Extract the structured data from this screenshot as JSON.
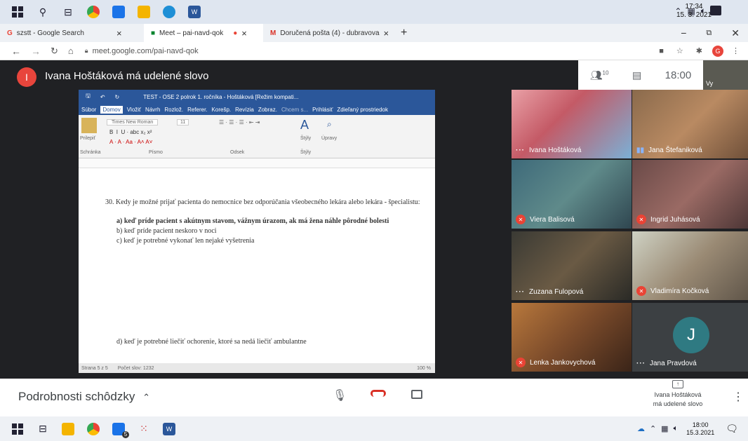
{
  "taskbar_top": {
    "icons": [
      "windows-icon",
      "search-icon",
      "task-view-icon",
      "chrome-icon",
      "mail-icon",
      "file-explorer-icon",
      "edge-icon",
      "word-icon"
    ],
    "clock_time": "17:34",
    "clock_date": "15. 3. 2021"
  },
  "tabs": [
    {
      "label": "szstt - Google Search"
    },
    {
      "label": "Meet – pai-navd-qok"
    },
    {
      "label": "Doručená pošta (4) - dubravova"
    }
  ],
  "address": {
    "url": "meet.google.com/pai-navd-qok"
  },
  "meet": {
    "presenter_initial": "I",
    "presenter_title": "Ivana Hoštáková má udelené slovo",
    "participants_count": "10",
    "time": "18:00",
    "self_label": "Vy"
  },
  "word": {
    "title": "TEST - OSE 2 polrok 1. ročníka - Hoštáková [Režim kompati...",
    "menu": [
      "Súbor",
      "Domov",
      "Vložiť",
      "Návrh",
      "Rozlož.",
      "Referer.",
      "Korešp.",
      "Revízia",
      "Zobraz.",
      "Chcem s...",
      "Prihlásiť",
      "Zdieľaný prostriedok"
    ],
    "font_name": "Times New Roman",
    "font_size": "11",
    "ribbon_paste": "Prilepiť",
    "ribbon_styles": "Štýly",
    "ribbon_edit": "Úpravy",
    "ribbon_groups": [
      "Schránka",
      "Písmo",
      "Odsek",
      "Štýly"
    ],
    "question": "30. Kedy je možné prijať pacienta do nemocnice bez odporúčania všeobecného lekára alebo lekára - špecialistu:",
    "answer_a": "a) keď príde pacient s akútnym stavom, vážnym úrazom, ak má žena náhle pôrodné bolesti",
    "answer_b": "b) keď príde pacient neskoro v noci",
    "answer_c": "c) keď je potrebné vykonať len nejaké vyšetrenia",
    "answer_d": "d) keď je potrebné liečiť ochorenie, ktoré sa nedá liečiť ambulantne",
    "status_page": "Strana 5 z 5",
    "status_words": "Počet slov: 1232",
    "zoom": "100 %"
  },
  "participants": [
    {
      "name": "Ivana Hoštáková",
      "status": "dots"
    },
    {
      "name": "Jana Štefaniková",
      "status": "bars"
    },
    {
      "name": "Viera Balisová",
      "status": "muted"
    },
    {
      "name": "Ingrid Juhásová",
      "status": "muted"
    },
    {
      "name": "Zuzana Fulopová",
      "status": "dots"
    },
    {
      "name": "Vladimíra Kočková",
      "status": "muted"
    },
    {
      "name": "Lenka Jankovychová",
      "status": "muted"
    },
    {
      "name": "Jana Pravdová",
      "status": "dots",
      "initial": "J"
    }
  ],
  "bottom": {
    "details_label": "Podrobnosti schôdzky",
    "presenting_line1": "Ivana Hoštáková",
    "presenting_line2": "má udelené slovo"
  },
  "taskbar_bottom": {
    "clock_time": "18:00",
    "clock_date": "15.3.2021",
    "mail_badge": "5"
  }
}
